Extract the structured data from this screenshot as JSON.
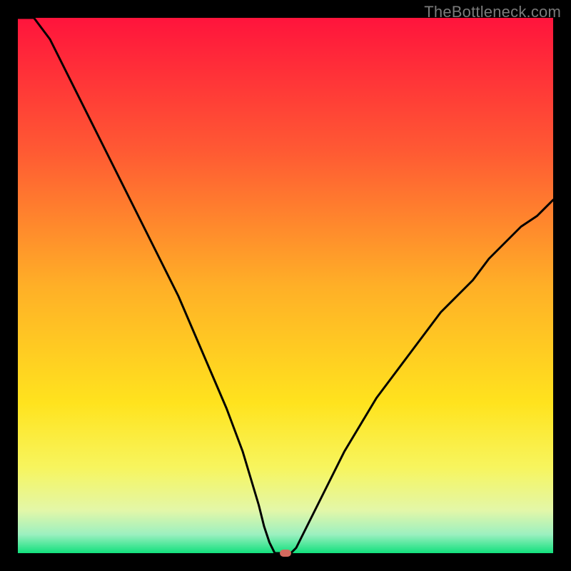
{
  "watermark": "TheBottleneck.com",
  "chart_data": {
    "type": "line",
    "title": "",
    "xlabel": "",
    "ylabel": "",
    "xlim": [
      0,
      100
    ],
    "ylim": [
      0,
      100
    ],
    "x": [
      0,
      3,
      6,
      9,
      12,
      15,
      18,
      21,
      24,
      27,
      30,
      33,
      36,
      39,
      42,
      45,
      46,
      47,
      48,
      49,
      50,
      51,
      52,
      53,
      55,
      58,
      61,
      64,
      67,
      70,
      73,
      76,
      79,
      82,
      85,
      88,
      91,
      94,
      97,
      100
    ],
    "values": [
      100,
      100,
      96,
      90,
      84,
      78,
      72,
      66,
      60,
      54,
      48,
      41,
      34,
      27,
      19,
      9,
      5,
      2,
      0,
      0,
      0,
      0,
      1,
      3,
      7,
      13,
      19,
      24,
      29,
      33,
      37,
      41,
      45,
      48,
      51,
      55,
      58,
      61,
      63,
      66
    ],
    "marker": {
      "x": 50,
      "y": 0
    },
    "background": {
      "type": "vertical-gradient",
      "stops": [
        {
          "pos": 0.0,
          "color": "#ff143c"
        },
        {
          "pos": 0.25,
          "color": "#ff5a33"
        },
        {
          "pos": 0.5,
          "color": "#ffaf27"
        },
        {
          "pos": 0.72,
          "color": "#ffe31e"
        },
        {
          "pos": 0.84,
          "color": "#f7f55e"
        },
        {
          "pos": 0.92,
          "color": "#e3f7a8"
        },
        {
          "pos": 0.965,
          "color": "#9cf0c0"
        },
        {
          "pos": 1.0,
          "color": "#12e07d"
        }
      ]
    }
  }
}
